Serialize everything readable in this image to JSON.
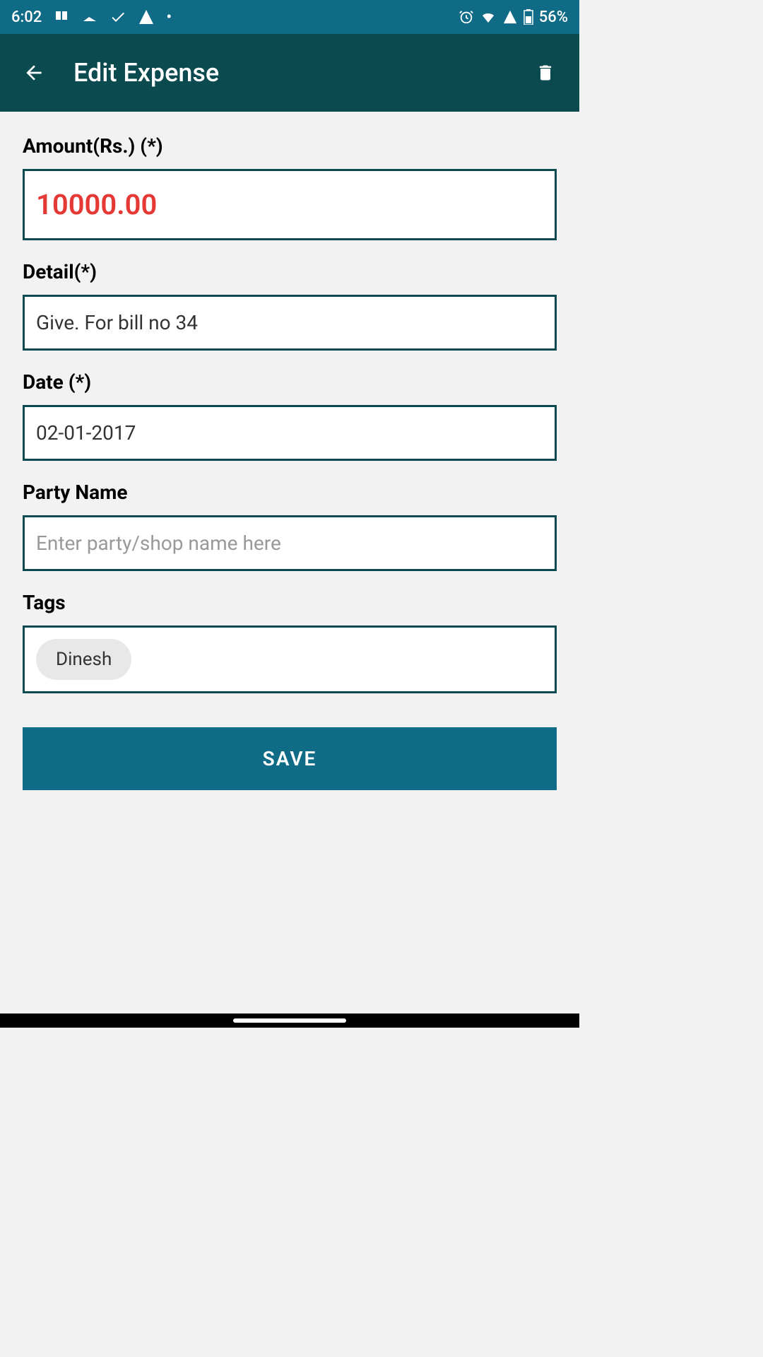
{
  "statusBar": {
    "time": "6:02",
    "battery": "56%"
  },
  "appBar": {
    "title": "Edit Expense"
  },
  "form": {
    "amount": {
      "label": "Amount(Rs.) (*)",
      "value": "10000.00"
    },
    "detail": {
      "label": "Detail(*)",
      "value": "Give. For bill no 34"
    },
    "date": {
      "label": "Date (*)",
      "value": "02-01-2017"
    },
    "party": {
      "label": "Party Name",
      "placeholder": "Enter party/shop name here",
      "value": ""
    },
    "tags": {
      "label": "Tags",
      "items": [
        "Dinesh"
      ]
    }
  },
  "buttons": {
    "save": "SAVE"
  }
}
